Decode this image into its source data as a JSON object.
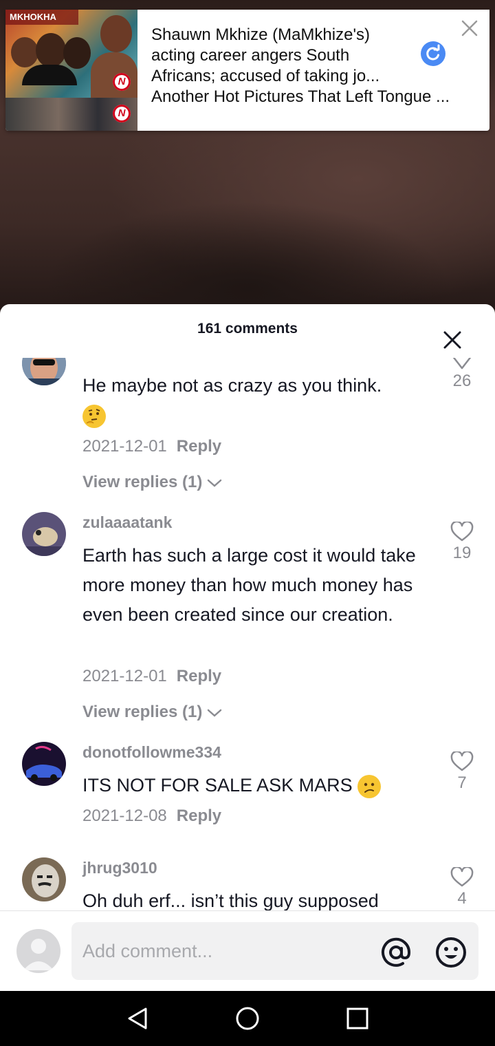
{
  "notification": {
    "thumb_banner": "MKHOKHA",
    "headline": "Shauwn Mkhize (MaMkhize's) acting career angers South Africans; accused of taking jo...",
    "subline": "Another Hot Pictures That Left Tongue ...",
    "badge_letter": "N"
  },
  "comments_sheet": {
    "title": "161 comments",
    "comments": [
      {
        "username": "",
        "text": "He maybe not as crazy as you think.",
        "emoji": "thinking-face-emoji",
        "date": "2021-12-01",
        "reply_label": "Reply",
        "view_replies": "View replies (1)",
        "likes": "26"
      },
      {
        "username": "zulaaaatank",
        "text": "Earth has such a large cost it would take more money than how much money has even been created since our creation.",
        "date": "2021-12-01",
        "reply_label": "Reply",
        "view_replies": "View replies (1)",
        "likes": "19"
      },
      {
        "username": "donotfollowme334",
        "text": "ITS NOT FOR SALE ASK MARS",
        "emoji": "confused-face-emoji",
        "date": "2021-12-08",
        "reply_label": "Reply",
        "likes": "7"
      },
      {
        "username": "jhrug3010",
        "text": "Oh duh erf... isn’t this guy supposed",
        "likes": "4"
      }
    ]
  },
  "composer": {
    "placeholder": "Add comment..."
  },
  "colors": {
    "sheet_bg": "#ffffff",
    "muted_text": "#8a8b91",
    "primary_text": "#161823",
    "refresh_blue": "#4a8af4"
  }
}
